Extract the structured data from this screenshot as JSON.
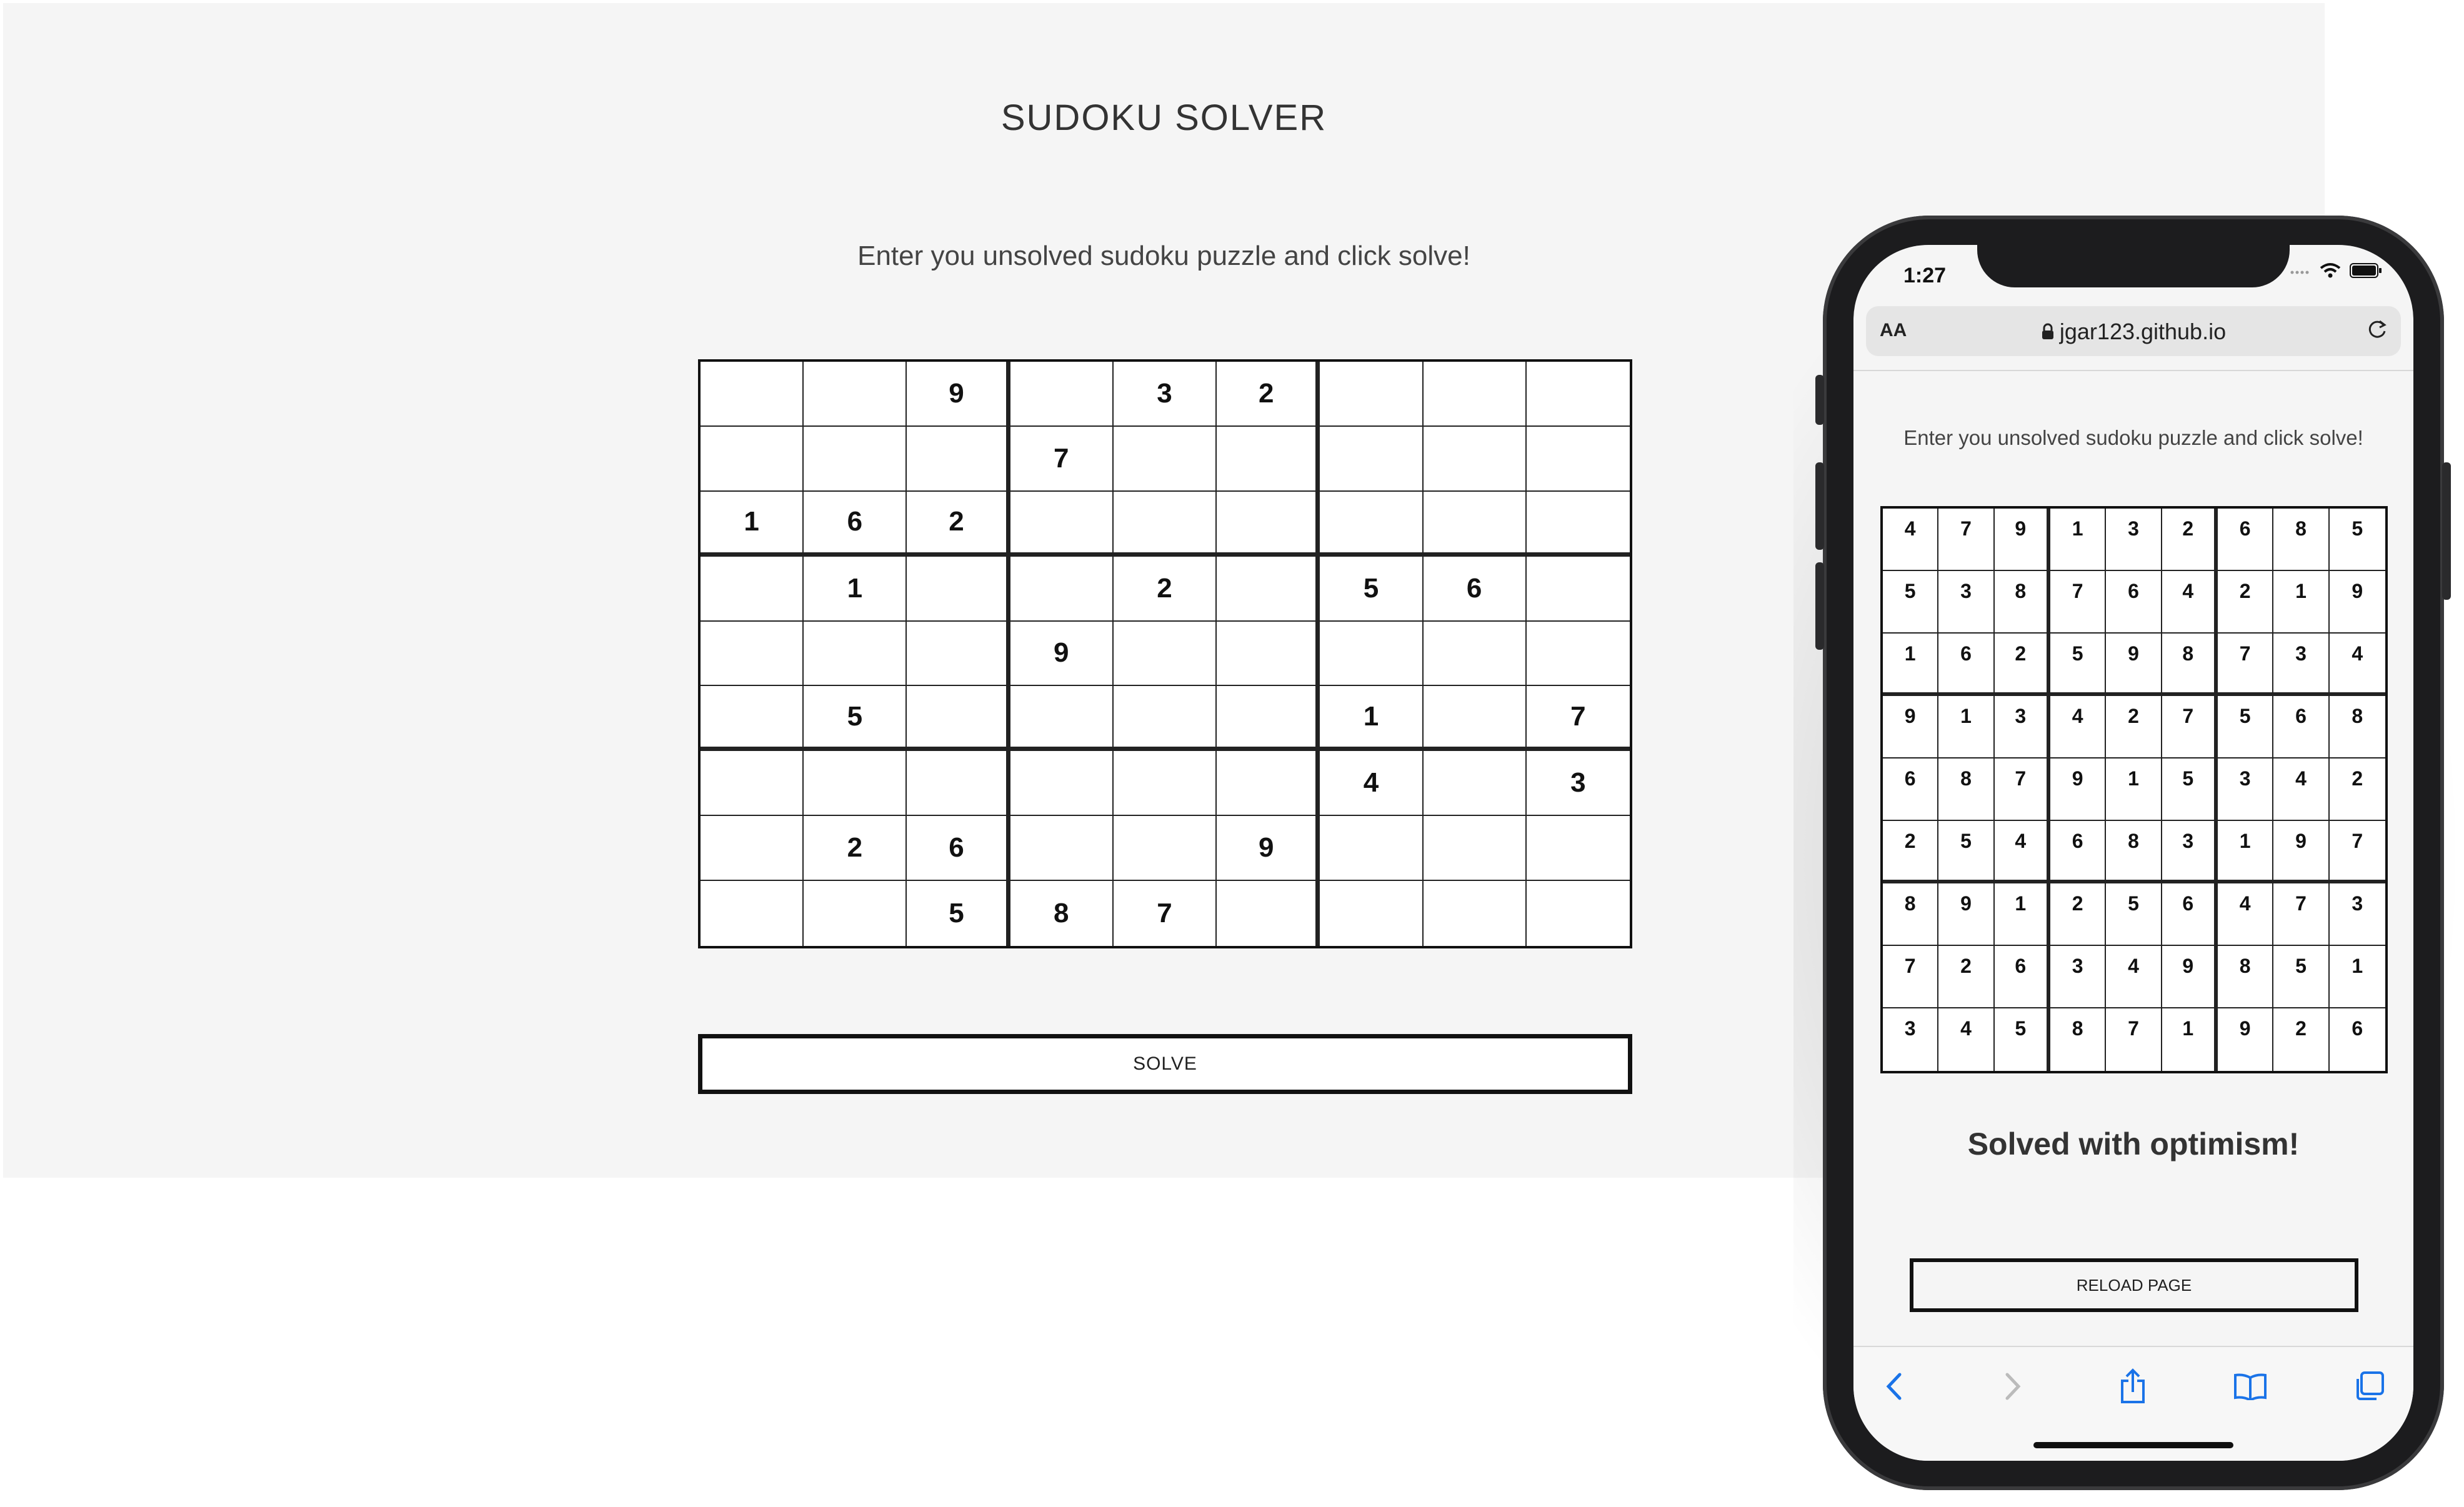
{
  "desktop": {
    "title": "SUDOKU SOLVER",
    "subtitle": "Enter you unsolved sudoku puzzle and click solve!",
    "grid": [
      [
        "",
        "",
        "9",
        "",
        "3",
        "2",
        "",
        "",
        ""
      ],
      [
        "",
        "",
        "",
        "7",
        "",
        "",
        "",
        "",
        ""
      ],
      [
        "1",
        "6",
        "2",
        "",
        "",
        "",
        "",
        "",
        ""
      ],
      [
        "",
        "1",
        "",
        "",
        "2",
        "",
        "5",
        "6",
        ""
      ],
      [
        "",
        "",
        "",
        "9",
        "",
        "",
        "",
        "",
        ""
      ],
      [
        "",
        "5",
        "",
        "",
        "",
        "",
        "1",
        "",
        "7"
      ],
      [
        "",
        "",
        "",
        "",
        "",
        "",
        "4",
        "",
        "3"
      ],
      [
        "",
        "2",
        "6",
        "",
        "",
        "9",
        "",
        "",
        ""
      ],
      [
        "",
        "",
        "5",
        "8",
        "7",
        "",
        "",
        "",
        ""
      ]
    ],
    "solve_label": "SOLVE"
  },
  "mobile": {
    "status_time": "1:27",
    "aa_label": "AA",
    "url": "jgar123.github.io",
    "subtitle": "Enter you unsolved sudoku puzzle and click solve!",
    "grid": [
      [
        "4",
        "7",
        "9",
        "1",
        "3",
        "2",
        "6",
        "8",
        "5"
      ],
      [
        "5",
        "3",
        "8",
        "7",
        "6",
        "4",
        "2",
        "1",
        "9"
      ],
      [
        "1",
        "6",
        "2",
        "5",
        "9",
        "8",
        "7",
        "3",
        "4"
      ],
      [
        "9",
        "1",
        "3",
        "4",
        "2",
        "7",
        "5",
        "6",
        "8"
      ],
      [
        "6",
        "8",
        "7",
        "9",
        "1",
        "5",
        "3",
        "4",
        "2"
      ],
      [
        "2",
        "5",
        "4",
        "6",
        "8",
        "3",
        "1",
        "9",
        "7"
      ],
      [
        "8",
        "9",
        "1",
        "2",
        "5",
        "6",
        "4",
        "7",
        "3"
      ],
      [
        "7",
        "2",
        "6",
        "3",
        "4",
        "9",
        "8",
        "5",
        "1"
      ],
      [
        "3",
        "4",
        "5",
        "8",
        "7",
        "1",
        "9",
        "2",
        "6"
      ]
    ],
    "solved_message": "Solved with optimism!",
    "reload_label": "RELOAD PAGE"
  },
  "icons": {
    "back": "chevron-left-icon",
    "forward": "chevron-right-icon",
    "share": "share-icon",
    "bookmarks": "book-icon",
    "tabs": "tabs-icon",
    "lock": "lock-icon",
    "reload": "reload-icon",
    "wifi": "wifi-icon",
    "battery": "battery-icon"
  },
  "colors": {
    "page_bg": "#f5f5f5",
    "text": "#333333",
    "accent": "#1a73e8"
  }
}
